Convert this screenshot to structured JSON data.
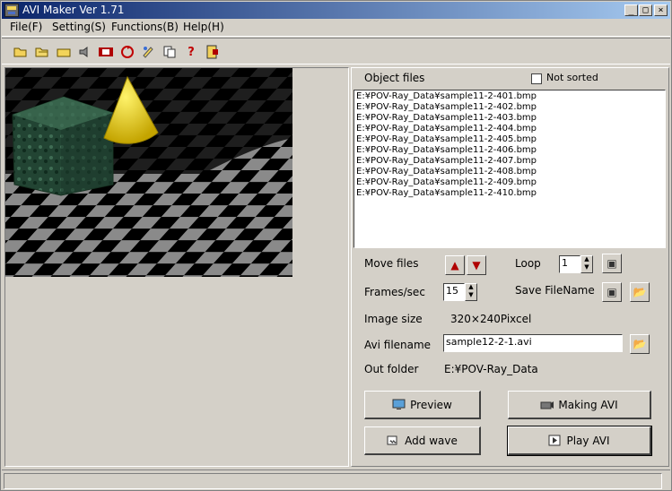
{
  "window": {
    "title": "AVI Maker Ver 1.71"
  },
  "menu": [
    {
      "label": "File(F)"
    },
    {
      "label": "Setting(S)"
    },
    {
      "label": "Functions(B)"
    },
    {
      "label": "Help(H)"
    }
  ],
  "toolbar": {
    "icons": [
      "open-folder-icon",
      "open-folder-alt-icon",
      "folder-icon",
      "sound-icon",
      "film-icon",
      "refresh-icon",
      "palette-icon",
      "copy-icon",
      "help-icon",
      "exit-icon"
    ]
  },
  "files": {
    "title": "Object files",
    "not_sorted_label": "Not sorted",
    "items": [
      "E:¥POV-Ray_Data¥sample11-2-401.bmp",
      "E:¥POV-Ray_Data¥sample11-2-402.bmp",
      "E:¥POV-Ray_Data¥sample11-2-403.bmp",
      "E:¥POV-Ray_Data¥sample11-2-404.bmp",
      "E:¥POV-Ray_Data¥sample11-2-405.bmp",
      "E:¥POV-Ray_Data¥sample11-2-406.bmp",
      "E:¥POV-Ray_Data¥sample11-2-407.bmp",
      "E:¥POV-Ray_Data¥sample11-2-408.bmp",
      "E:¥POV-Ray_Data¥sample11-2-409.bmp",
      "E:¥POV-Ray_Data¥sample11-2-410.bmp"
    ]
  },
  "settings": {
    "move_files": "Move files",
    "loop": "Loop",
    "loop_value": "1",
    "frames_sec": "Frames/sec",
    "frames_value": "15",
    "save_filename": "Save FileName",
    "image_size": "Image size",
    "image_size_value": "320×240Pixcel",
    "avi_filename": "Avi filename",
    "avi_filename_value": "sample12-2-1.avi",
    "out_folder": "Out folder",
    "out_folder_value": "E:¥POV-Ray_Data"
  },
  "buttons": {
    "preview": "Preview",
    "making_avi": "Making AVI",
    "add_wave": "Add wave",
    "play_avi": "Play AVI"
  },
  "colors": {
    "title_start": "#0a246a",
    "title_end": "#a6caf0",
    "window": "#d4d0c8"
  }
}
